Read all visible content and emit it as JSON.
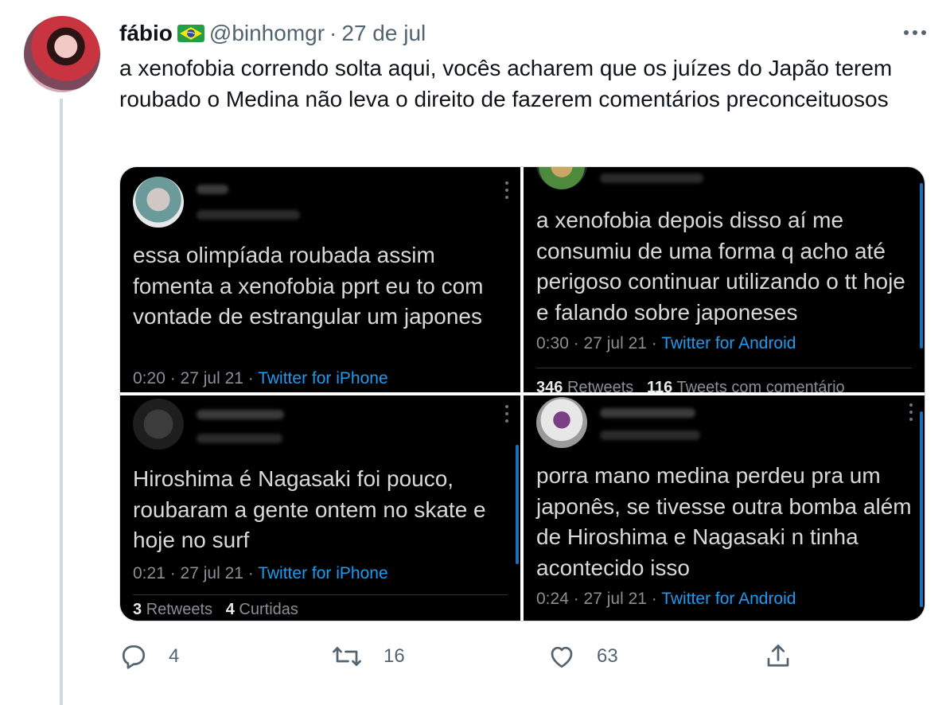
{
  "author": {
    "display_name": "fábio",
    "flag_icon": "brazil-flag-icon",
    "handle": "@binhomgr",
    "separator": "·",
    "date": "27 de jul"
  },
  "tweet": {
    "text": "a xenofobia correndo solta aqui, vocês acharem que os juízes do Japão terem roubado o Medina não leva o direito de fazerem comentários preconceituosos"
  },
  "media": {
    "screenshots": [
      {
        "text": "essa olimpíada roubada assim fomenta a xenofobia pprt eu to com vontade de estrangular um japones",
        "time": "0:20 · 27 jul 21 · ",
        "source": "Twitter for iPhone"
      },
      {
        "text": "a xenofobia depois disso aí me consumiu de uma forma q acho até perigoso continuar utilizando o tt hoje e falando sobre japoneses",
        "time": "0:30 · 27 jul 21 · ",
        "source": "Twitter for Android",
        "stats": {
          "retweets_count": "346",
          "retweets_label": "Retweets",
          "quotes_count": "116",
          "quotes_label": "Tweets com comentário"
        }
      },
      {
        "text": "Hiroshima é Nagasaki foi pouco, roubaram a gente ontem no skate e hoje no surf",
        "time": "0:21 · 27 jul 21 · ",
        "source": "Twitter for iPhone",
        "stats": {
          "retweets_count": "3",
          "retweets_label": "Retweets",
          "likes_count": "4",
          "likes_label": "Curtidas"
        }
      },
      {
        "text": "porra mano medina perdeu pra um japonês, se tivesse outra bomba além de Hiroshima e Nagasaki n tinha acontecido isso",
        "time": "0:24 · 27 jul 21 · ",
        "source": "Twitter for Android"
      }
    ]
  },
  "actions": {
    "reply_count": "4",
    "retweet_count": "16",
    "like_count": "63",
    "reply_icon": "reply-icon",
    "retweet_icon": "retweet-icon",
    "like_icon": "heart-icon",
    "share_icon": "share-icon"
  },
  "colors": {
    "text_primary": "#0f1419",
    "text_secondary": "#536471",
    "link_blue": "#1d9bf0",
    "thread_line": "#cfd9de",
    "screenshot_bg": "#000000"
  }
}
